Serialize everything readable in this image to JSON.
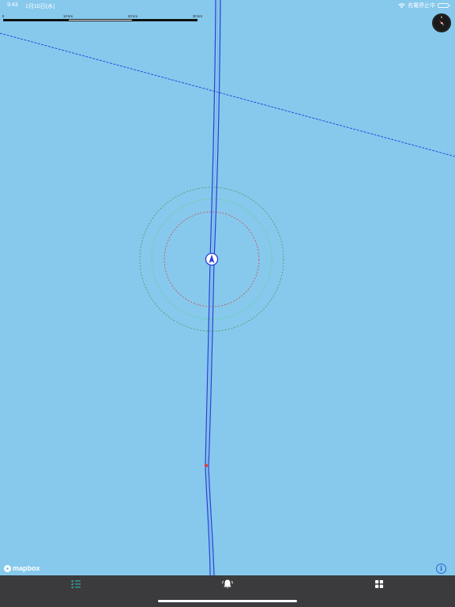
{
  "status_bar": {
    "time": "9:43",
    "date": "1月10日(水)",
    "charging_status": "充電停止中"
  },
  "scale_bar": {
    "labels": [
      "0",
      "10 km",
      "20 km",
      "30 km"
    ]
  },
  "map": {
    "attribution": "mapbox",
    "info_symbol": "i",
    "water_color": "#86c9ec",
    "track_color": "#2a3fd6",
    "heading_line_color": "#1f3fe0",
    "range_ring_colors": [
      "#d04a4a",
      "#3fa060",
      "#5fd18a"
    ],
    "current_position_icon": "navigation-arrow-icon",
    "waypoint_marker": "red-dot-marker"
  },
  "tab_bar": {
    "items": [
      {
        "name": "list-icon",
        "active": false
      },
      {
        "name": "alarm-bell-icon",
        "active": true
      },
      {
        "name": "grid-icon",
        "active": false
      }
    ],
    "accent_color": "#2ec4b6"
  },
  "compass": {
    "icon": "compass-icon"
  }
}
